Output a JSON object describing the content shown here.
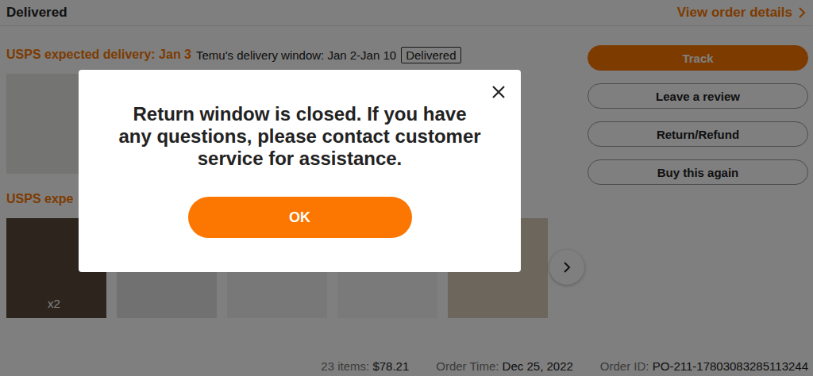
{
  "header": {
    "status": "Delivered",
    "details_link": "View order details"
  },
  "packages": [
    {
      "delivery": "USPS expected delivery: Jan 3",
      "window": "Temu's delivery window: Jan 2-Jan 10",
      "badge": "Delivered",
      "items": [
        {}
      ]
    },
    {
      "delivery": "USPS expe",
      "items": [
        {
          "quantity": "x2"
        },
        {},
        {},
        {},
        {}
      ]
    }
  ],
  "actions": [
    {
      "label": "Track",
      "primary": true
    },
    {
      "label": "Leave a review",
      "primary": false
    },
    {
      "label": "Return/Refund",
      "primary": false
    },
    {
      "label": "Buy this again",
      "primary": false
    }
  ],
  "summary": {
    "count": "23 items:",
    "total": "$78.21",
    "order_time_label": "Order Time:",
    "order_time": "Dec 25, 2022",
    "order_id_label": "Order ID:",
    "order_id": "PO-211-17803083285113244"
  },
  "dialog": {
    "message": "Return window is closed. If you have any questions, please contact customer service for assistance.",
    "button": "OK"
  }
}
